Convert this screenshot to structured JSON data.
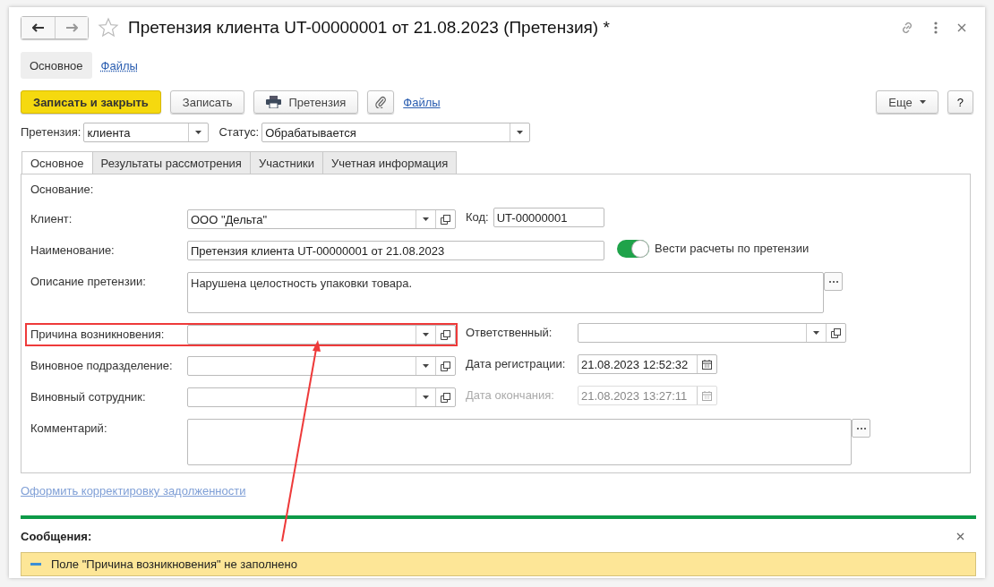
{
  "window": {
    "title": "Претензия клиента UT-00000001 от 21.08.2023 (Претензия) *"
  },
  "header_tabs": [
    {
      "label": "Основное",
      "selected": true
    },
    {
      "label": "Файлы",
      "selected": false
    }
  ],
  "toolbar": {
    "save_close": "Записать и закрыть",
    "save": "Записать",
    "print": "Претензия",
    "files_link": "Файлы",
    "more": "Еще",
    "help": "?"
  },
  "claim_type": {
    "label": "Претензия:",
    "value": "клиента"
  },
  "status": {
    "label": "Статус:",
    "value": "Обрабатывается"
  },
  "tabs": [
    {
      "label": "Основное",
      "selected": true
    },
    {
      "label": "Результаты рассмотрения",
      "selected": false
    },
    {
      "label": "Участники",
      "selected": false
    },
    {
      "label": "Учетная информация",
      "selected": false
    }
  ],
  "form": {
    "basis_label": "Основание:",
    "rows": [
      {
        "label": "Клиент:",
        "kind": "ref",
        "value": "ООО \"Дельта\"",
        "highlighted": false,
        "right": {
          "kind": "text",
          "label": "Код:",
          "value": "UT-00000001"
        }
      },
      {
        "label": "Наименование:",
        "kind": "text",
        "value": "Претензия клиента UT-00000001 от 21.08.2023",
        "highlighted": false,
        "right": {
          "kind": "toggle",
          "label": "Вести расчеты по претензии",
          "on": true
        }
      },
      {
        "label": "Описание претензии:",
        "kind": "memo",
        "value": "Нарушена целостность упаковки товара.",
        "highlighted": false
      },
      {
        "label": "Причина возникновения:",
        "kind": "ref",
        "highlighted": true,
        "right": {
          "kind": "ref",
          "label": "Ответственный:"
        }
      },
      {
        "label": "Виновное подразделение:",
        "kind": "ref",
        "highlighted": false,
        "right": {
          "kind": "date",
          "label": "Дата регистрации:",
          "value": "21.08.2023 12:52:32",
          "disabled": false
        }
      },
      {
        "label": "Виновный сотрудник:",
        "kind": "ref",
        "highlighted": false,
        "right": {
          "kind": "date",
          "label": "Дата окончания:",
          "value": "21.08.2023 13:27:11",
          "disabled": true
        }
      },
      {
        "label": "Комментарий:",
        "kind": "comment",
        "highlighted": false
      }
    ]
  },
  "debt_link": "Оформить корректировку задолженности",
  "messages": {
    "title": "Сообщения:",
    "items": [
      "Поле \"Причина возникновения\" не заполнено"
    ]
  }
}
